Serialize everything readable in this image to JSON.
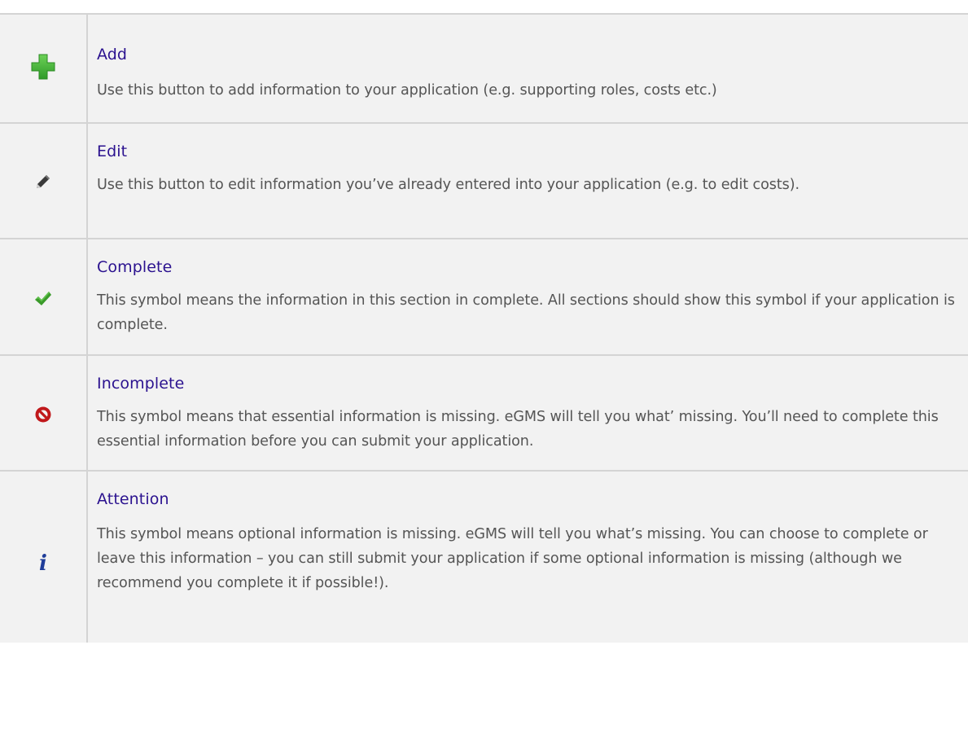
{
  "rows": [
    {
      "icon": "plus-icon",
      "title": "Add",
      "description": "Use this button to add information to your application (e.g. supporting roles, costs etc.)"
    },
    {
      "icon": "pencil-icon",
      "title": "Edit",
      "description": "Use this button to edit information you’ve already entered into your application (e.g. to edit costs)."
    },
    {
      "icon": "checkmark-icon",
      "title": "Complete",
      "description": "This symbol means the information in this section in complete. All sections should show this symbol if your application is complete."
    },
    {
      "icon": "prohibited-icon",
      "title": "Incomplete",
      "description": "This symbol means that essential information is missing. eGMS will tell you what’ missing. You’ll need to complete this essential information before you can submit your application."
    },
    {
      "icon": "info-icon",
      "title": "Attention",
      "description": "This symbol means optional information is missing. eGMS will tell you what’s missing. You can choose to complete or leave this information – you can still submit your application if some optional information is missing (although we recommend you complete it if possible!)."
    }
  ],
  "colors": {
    "title": "#2b128f",
    "body_text": "#555555",
    "row_background": "#f2f2f2",
    "border": "#d4d4d4",
    "plus_green": "#3aa832",
    "check_green": "#3a9a2a",
    "prohibited_red": "#c0181b",
    "info_blue": "#1f3d99"
  }
}
